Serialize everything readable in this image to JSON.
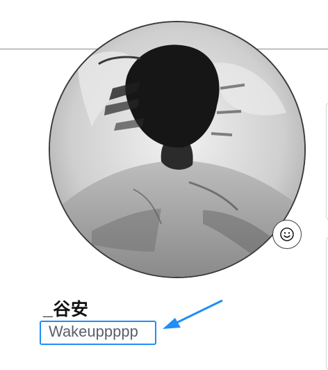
{
  "profile": {
    "display_name": "_谷安",
    "username": "Wakeuppppp"
  },
  "avatar": {
    "description_icon": "avatar-image"
  },
  "status": {
    "icon": "smiley-icon"
  },
  "annotation": {
    "color": "#1f8ef5"
  }
}
